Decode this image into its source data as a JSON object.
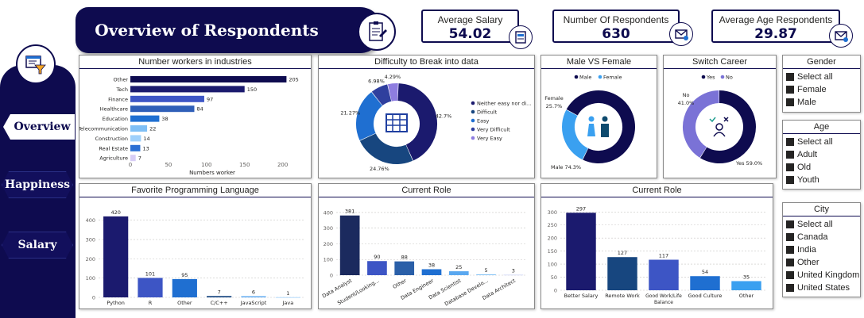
{
  "header": {
    "title": "Overview of Respondents"
  },
  "nav": {
    "overview": "Overview",
    "happiness": "Happiness",
    "salary": "Salary"
  },
  "kpis": {
    "salary": {
      "label": "Average Salary",
      "value": "54.02"
    },
    "respondents": {
      "label": "Number Of Respondents",
      "value": "630"
    },
    "age": {
      "label": "Average Age Respondents",
      "value": "29.87"
    }
  },
  "colors": {
    "navy": "#0e0b4f",
    "dark": "#1b1a6e",
    "mid": "#3d55c5",
    "blue": "#1f6fd1",
    "light": "#5aa8f0",
    "pale": "#9fd0fb"
  },
  "slicers": {
    "gender": {
      "title": "Gender",
      "items": [
        "Select all",
        "Female",
        "Male"
      ]
    },
    "age": {
      "title": "Age",
      "items": [
        "Select all",
        "Adult",
        "Old",
        "Youth"
      ]
    },
    "city": {
      "title": "City",
      "items": [
        "Select all",
        "Canada",
        "India",
        "Other",
        "United Kingdom",
        "United States"
      ]
    }
  },
  "chart_data": [
    {
      "id": "industries",
      "type": "bar",
      "orientation": "horizontal",
      "title": "Number workers in industries",
      "xlabel": "Numbers worker",
      "categories": [
        "Other",
        "Tech",
        "Finance",
        "Healthcare",
        "Education",
        "Telecommunication",
        "Construction",
        "Real Estate",
        "Agriculture"
      ],
      "values": [
        205,
        150,
        97,
        84,
        38,
        22,
        14,
        13,
        7
      ],
      "colors": [
        "#0e0b4f",
        "#1b1a6e",
        "#3d55c5",
        "#2f5fb8",
        "#1f6fd1",
        "#7fbff5",
        "#9fd0fb",
        "#2a6fd4",
        "#d7cdf5"
      ],
      "xticks": [
        0,
        50,
        100,
        150,
        200
      ],
      "xlim": [
        0,
        215
      ]
    },
    {
      "id": "difficulty",
      "type": "pie",
      "donut": true,
      "title": "Difficulty to Break into data",
      "categories": [
        "Neither easy nor di...",
        "Difficult",
        "Easy",
        "Very Difficult",
        "Very Easy"
      ],
      "labels": [
        "42.7%",
        "24.76%",
        "21.27%",
        "6.98%",
        "4.29%"
      ],
      "values": [
        42.7,
        24.76,
        21.27,
        6.98,
        4.29
      ],
      "colors": [
        "#1b1a6e",
        "#17467f",
        "#1f6fd1",
        "#2f3f9e",
        "#8e7de0"
      ],
      "legend": "right"
    },
    {
      "id": "gender",
      "type": "pie",
      "donut": true,
      "title": "Male VS Female",
      "categories": [
        "Male",
        "Female"
      ],
      "labels": [
        "Male 74.3%",
        "Female 25.7%"
      ],
      "values": [
        74.3,
        25.7
      ],
      "colors": [
        "#0e0b4f",
        "#3aa0f0"
      ],
      "legend": "top"
    },
    {
      "id": "switch",
      "type": "pie",
      "donut": true,
      "title": "Switch Career",
      "categories": [
        "Yes",
        "No"
      ],
      "labels": [
        "Yes 59.0%",
        "No 41.0%"
      ],
      "values": [
        59.0,
        41.0
      ],
      "colors": [
        "#0e0b4f",
        "#7a72d6"
      ],
      "legend": "top"
    },
    {
      "id": "languages",
      "type": "bar",
      "title": "Favorite Programming Language",
      "categories": [
        "Python",
        "R",
        "Other",
        "C/C++",
        "JavaScript",
        "Java"
      ],
      "values": [
        420,
        101,
        95,
        7,
        6,
        1
      ],
      "colors": [
        "#1b1a6e",
        "#3d55c5",
        "#1f6fd1",
        "#17467f",
        "#5aa8f0",
        "#9fd0fb"
      ],
      "yticks": [
        0,
        100,
        200,
        300,
        400
      ],
      "ylim": [
        0,
        440
      ]
    },
    {
      "id": "role",
      "type": "bar",
      "title": "Current Role",
      "categories": [
        "Data Analyst",
        "Student/Looking...",
        "Other",
        "Data Engineer",
        "Data Scientist",
        "Database Develo...",
        "Data Architect"
      ],
      "values": [
        381,
        90,
        88,
        38,
        25,
        5,
        3
      ],
      "colors": [
        "#1b2a5e",
        "#3d55c5",
        "#2a5fa8",
        "#1f6fd1",
        "#5aa8f0",
        "#7fbff5",
        "#cfd4f5"
      ],
      "yticks": [
        0,
        100,
        200,
        300,
        400
      ],
      "ylim": [
        0,
        410
      ]
    },
    {
      "id": "role2",
      "type": "bar",
      "title": "Current Role",
      "categories": [
        "Better Salary",
        "Remote Work",
        "Good Work/Life Balance",
        "Good Culture",
        "Other"
      ],
      "values": [
        297,
        127,
        117,
        54,
        35
      ],
      "colors": [
        "#1b1a6e",
        "#17467f",
        "#3d55c5",
        "#1f6fd1",
        "#3aa0f0"
      ],
      "yticks": [
        0,
        50,
        100,
        150,
        200,
        250,
        300
      ],
      "ylim": [
        0,
        310
      ]
    }
  ]
}
